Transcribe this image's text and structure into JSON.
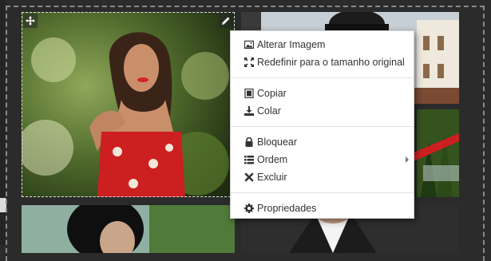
{
  "context_menu": {
    "change_image": "Alterar Imagem",
    "reset_size": "Redefinir para o tamanho original",
    "copy": "Copiar",
    "paste": "Colar",
    "lock": "Bloquear",
    "order": "Ordem",
    "delete": "Excluir",
    "properties": "Propriedades"
  },
  "icons": {
    "move": "move-icon",
    "edit": "pencil-icon",
    "image": "image-icon",
    "resize": "expand-icon",
    "copy": "copy-icon",
    "paste": "download-icon",
    "lock": "lock-icon",
    "order": "list-icon",
    "delete": "close-icon",
    "properties": "gear-icon"
  },
  "colors": {
    "background": "#2b2b2b",
    "menu_background": "#ffffff",
    "menu_text": "#333333",
    "accent_red": "#cc1f1f"
  }
}
